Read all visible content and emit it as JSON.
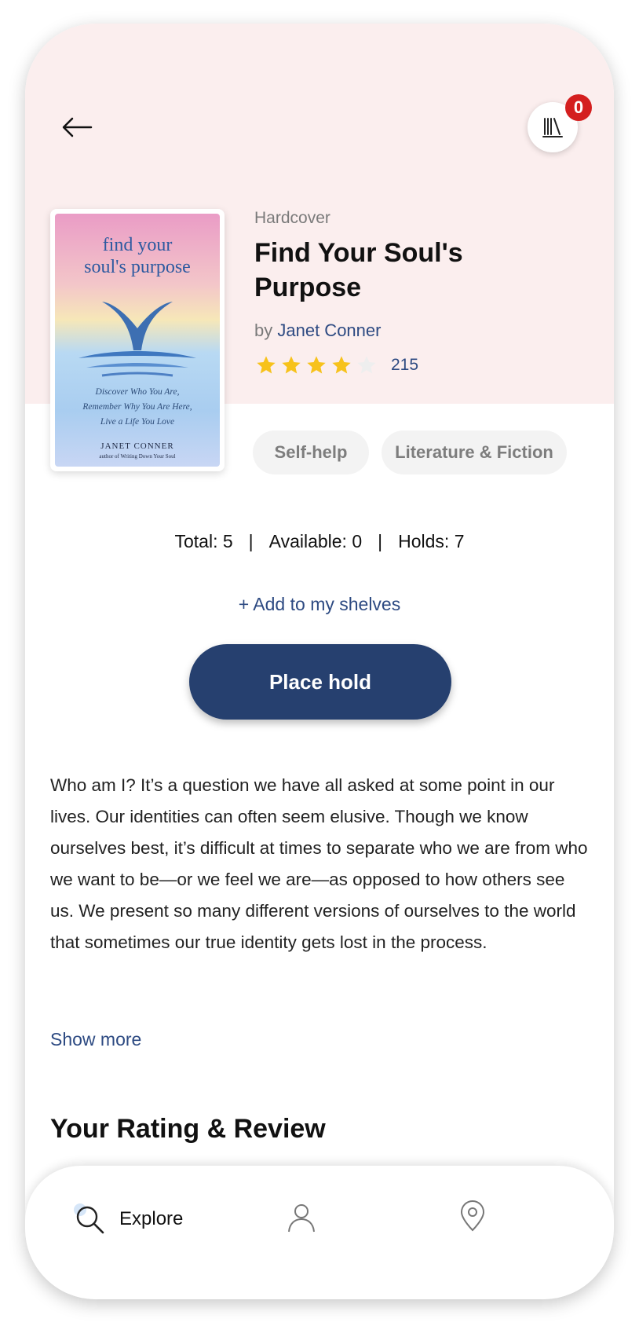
{
  "header": {
    "back_icon": "arrow-left-icon",
    "shelf_icon": "library-icon",
    "shelf_badge": "0"
  },
  "book": {
    "cover": {
      "title_line1": "find your",
      "title_line2": "soul's purpose",
      "tagline_line1": "Discover Who You Are,",
      "tagline_line2": "Remember Why You Are Here,",
      "tagline_line3": "Live a Life You Love",
      "author": "JANET CONNER",
      "author_note": "author of Writing Down Your Soul"
    },
    "format": "Hardcover",
    "title": "Find Your Soul's Purpose",
    "by_label": "by",
    "author": "Janet Conner",
    "rating": 4,
    "rating_max": 5,
    "rating_count": "215",
    "genres": [
      "Self-help",
      "Literature & Fiction"
    ]
  },
  "availability": {
    "total": "Total: 5",
    "available": "Available: 0",
    "holds": "Holds: 7",
    "separator": "|"
  },
  "actions": {
    "add_shelves": "+ Add to my shelves",
    "place_hold": "Place hold"
  },
  "description": {
    "text": "Who am I? It’s a question we have all asked at some point in our lives. Our identities can often seem elusive. Though we know ourselves best, it’s difficult at times to separate who we are from who we want to be—or we feel we are—as opposed to how others see us. We present so many different versions of ourselves to the world that sometimes our true identity gets lost in the process.",
    "show_more": "Show more"
  },
  "review_section": {
    "heading": "Your Rating & Review"
  },
  "tabbar": {
    "explore_label": "Explore",
    "explore_icon": "search-icon",
    "profile_icon": "user-icon",
    "location_icon": "map-pin-icon"
  },
  "colors": {
    "header_bg": "#fbeeee",
    "accent": "#26406f",
    "link": "#2d4a82",
    "star": "#f7c21b",
    "badge": "#d41f1f"
  }
}
